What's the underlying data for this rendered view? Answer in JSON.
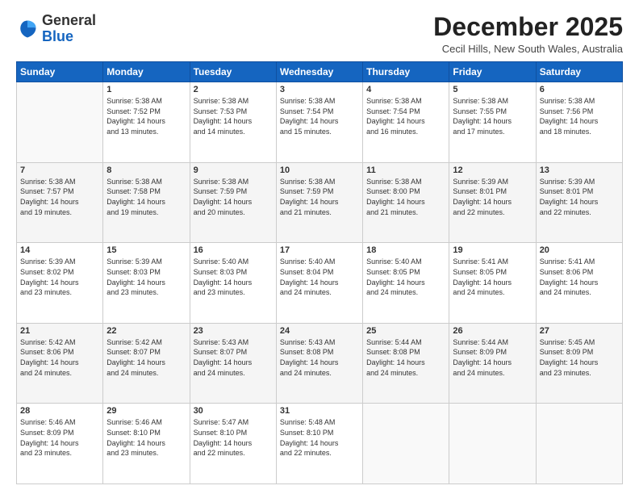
{
  "header": {
    "logo_general": "General",
    "logo_blue": "Blue",
    "month_title": "December 2025",
    "location": "Cecil Hills, New South Wales, Australia"
  },
  "weekdays": [
    "Sunday",
    "Monday",
    "Tuesday",
    "Wednesday",
    "Thursday",
    "Friday",
    "Saturday"
  ],
  "weeks": [
    [
      {
        "day": "",
        "info": ""
      },
      {
        "day": "1",
        "info": "Sunrise: 5:38 AM\nSunset: 7:52 PM\nDaylight: 14 hours\nand 13 minutes."
      },
      {
        "day": "2",
        "info": "Sunrise: 5:38 AM\nSunset: 7:53 PM\nDaylight: 14 hours\nand 14 minutes."
      },
      {
        "day": "3",
        "info": "Sunrise: 5:38 AM\nSunset: 7:54 PM\nDaylight: 14 hours\nand 15 minutes."
      },
      {
        "day": "4",
        "info": "Sunrise: 5:38 AM\nSunset: 7:54 PM\nDaylight: 14 hours\nand 16 minutes."
      },
      {
        "day": "5",
        "info": "Sunrise: 5:38 AM\nSunset: 7:55 PM\nDaylight: 14 hours\nand 17 minutes."
      },
      {
        "day": "6",
        "info": "Sunrise: 5:38 AM\nSunset: 7:56 PM\nDaylight: 14 hours\nand 18 minutes."
      }
    ],
    [
      {
        "day": "7",
        "info": "Sunrise: 5:38 AM\nSunset: 7:57 PM\nDaylight: 14 hours\nand 19 minutes."
      },
      {
        "day": "8",
        "info": "Sunrise: 5:38 AM\nSunset: 7:58 PM\nDaylight: 14 hours\nand 19 minutes."
      },
      {
        "day": "9",
        "info": "Sunrise: 5:38 AM\nSunset: 7:59 PM\nDaylight: 14 hours\nand 20 minutes."
      },
      {
        "day": "10",
        "info": "Sunrise: 5:38 AM\nSunset: 7:59 PM\nDaylight: 14 hours\nand 21 minutes."
      },
      {
        "day": "11",
        "info": "Sunrise: 5:38 AM\nSunset: 8:00 PM\nDaylight: 14 hours\nand 21 minutes."
      },
      {
        "day": "12",
        "info": "Sunrise: 5:39 AM\nSunset: 8:01 PM\nDaylight: 14 hours\nand 22 minutes."
      },
      {
        "day": "13",
        "info": "Sunrise: 5:39 AM\nSunset: 8:01 PM\nDaylight: 14 hours\nand 22 minutes."
      }
    ],
    [
      {
        "day": "14",
        "info": "Sunrise: 5:39 AM\nSunset: 8:02 PM\nDaylight: 14 hours\nand 23 minutes."
      },
      {
        "day": "15",
        "info": "Sunrise: 5:39 AM\nSunset: 8:03 PM\nDaylight: 14 hours\nand 23 minutes."
      },
      {
        "day": "16",
        "info": "Sunrise: 5:40 AM\nSunset: 8:03 PM\nDaylight: 14 hours\nand 23 minutes."
      },
      {
        "day": "17",
        "info": "Sunrise: 5:40 AM\nSunset: 8:04 PM\nDaylight: 14 hours\nand 24 minutes."
      },
      {
        "day": "18",
        "info": "Sunrise: 5:40 AM\nSunset: 8:05 PM\nDaylight: 14 hours\nand 24 minutes."
      },
      {
        "day": "19",
        "info": "Sunrise: 5:41 AM\nSunset: 8:05 PM\nDaylight: 14 hours\nand 24 minutes."
      },
      {
        "day": "20",
        "info": "Sunrise: 5:41 AM\nSunset: 8:06 PM\nDaylight: 14 hours\nand 24 minutes."
      }
    ],
    [
      {
        "day": "21",
        "info": "Sunrise: 5:42 AM\nSunset: 8:06 PM\nDaylight: 14 hours\nand 24 minutes."
      },
      {
        "day": "22",
        "info": "Sunrise: 5:42 AM\nSunset: 8:07 PM\nDaylight: 14 hours\nand 24 minutes."
      },
      {
        "day": "23",
        "info": "Sunrise: 5:43 AM\nSunset: 8:07 PM\nDaylight: 14 hours\nand 24 minutes."
      },
      {
        "day": "24",
        "info": "Sunrise: 5:43 AM\nSunset: 8:08 PM\nDaylight: 14 hours\nand 24 minutes."
      },
      {
        "day": "25",
        "info": "Sunrise: 5:44 AM\nSunset: 8:08 PM\nDaylight: 14 hours\nand 24 minutes."
      },
      {
        "day": "26",
        "info": "Sunrise: 5:44 AM\nSunset: 8:09 PM\nDaylight: 14 hours\nand 24 minutes."
      },
      {
        "day": "27",
        "info": "Sunrise: 5:45 AM\nSunset: 8:09 PM\nDaylight: 14 hours\nand 23 minutes."
      }
    ],
    [
      {
        "day": "28",
        "info": "Sunrise: 5:46 AM\nSunset: 8:09 PM\nDaylight: 14 hours\nand 23 minutes."
      },
      {
        "day": "29",
        "info": "Sunrise: 5:46 AM\nSunset: 8:10 PM\nDaylight: 14 hours\nand 23 minutes."
      },
      {
        "day": "30",
        "info": "Sunrise: 5:47 AM\nSunset: 8:10 PM\nDaylight: 14 hours\nand 22 minutes."
      },
      {
        "day": "31",
        "info": "Sunrise: 5:48 AM\nSunset: 8:10 PM\nDaylight: 14 hours\nand 22 minutes."
      },
      {
        "day": "",
        "info": ""
      },
      {
        "day": "",
        "info": ""
      },
      {
        "day": "",
        "info": ""
      }
    ]
  ]
}
